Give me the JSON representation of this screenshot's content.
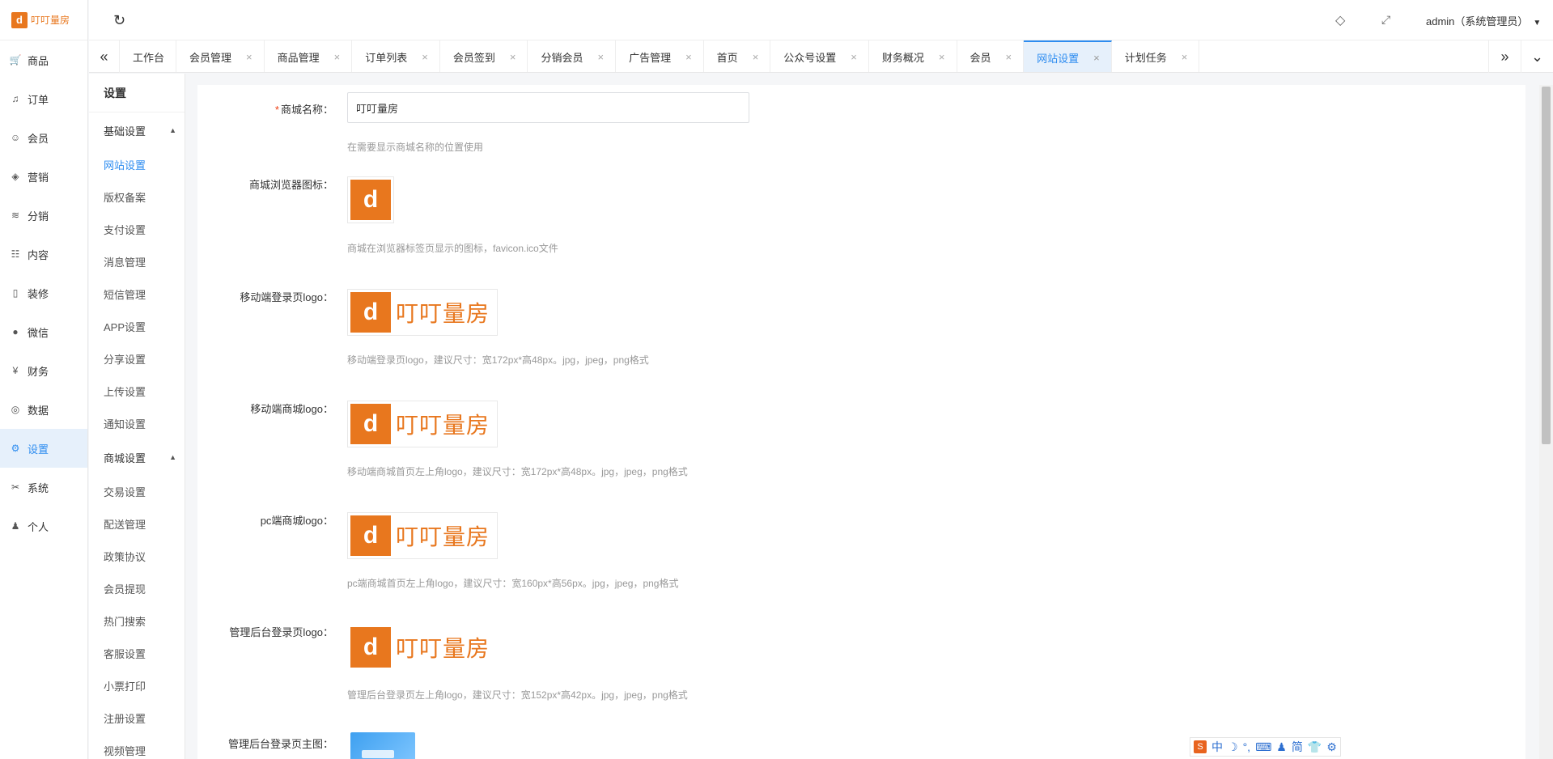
{
  "brand": {
    "logo_text": "叮叮量房",
    "logo_glyph": "d",
    "accent": "#e8771e"
  },
  "left_nav": [
    {
      "label": "商品",
      "icon": "cart-icon",
      "glyph": "🛒"
    },
    {
      "label": "订单",
      "icon": "bell-icon",
      "glyph": "♫"
    },
    {
      "label": "会员",
      "icon": "user-icon",
      "glyph": "☺"
    },
    {
      "label": "营销",
      "icon": "cube-icon",
      "glyph": "◈"
    },
    {
      "label": "分销",
      "icon": "layers-icon",
      "glyph": "≋"
    },
    {
      "label": "内容",
      "icon": "book-icon",
      "glyph": "☷"
    },
    {
      "label": "装修",
      "icon": "phone-icon",
      "glyph": "▯"
    },
    {
      "label": "微信",
      "icon": "wechat-icon",
      "glyph": "●"
    },
    {
      "label": "财务",
      "icon": "yen-icon",
      "glyph": "¥"
    },
    {
      "label": "数据",
      "icon": "globe-icon",
      "glyph": "◎"
    },
    {
      "label": "设置",
      "icon": "gear-icon",
      "glyph": "⚙"
    },
    {
      "label": "系统",
      "icon": "tools-icon",
      "glyph": "✂"
    },
    {
      "label": "个人",
      "icon": "person-icon",
      "glyph": "♟"
    }
  ],
  "header": {
    "user_label": "admin（系统管理员）",
    "refresh_glyph": "↻",
    "tag_glyph": "◇",
    "fullscreen_glyph": "⤢"
  },
  "tabs": [
    {
      "label": "工作台",
      "closable": false
    },
    {
      "label": "会员管理",
      "closable": true
    },
    {
      "label": "商品管理",
      "closable": true
    },
    {
      "label": "订单列表",
      "closable": true
    },
    {
      "label": "会员签到",
      "closable": true
    },
    {
      "label": "分销会员",
      "closable": true
    },
    {
      "label": "广告管理",
      "closable": true
    },
    {
      "label": "首页",
      "closable": true
    },
    {
      "label": "公众号设置",
      "closable": true
    },
    {
      "label": "财务概况",
      "closable": true
    },
    {
      "label": "会员",
      "closable": true
    },
    {
      "label": "网站设置",
      "closable": true,
      "active": true
    },
    {
      "label": "计划任务",
      "closable": true
    }
  ],
  "submenu": {
    "title": "设置",
    "groups": [
      {
        "label": "基础设置",
        "items": [
          "网站设置",
          "版权备案",
          "支付设置",
          "消息管理",
          "短信管理",
          "APP设置",
          "分享设置",
          "上传设置",
          "通知设置"
        ]
      },
      {
        "label": "商城设置",
        "items": [
          "交易设置",
          "配送管理",
          "政策协议",
          "会员提现",
          "热门搜索",
          "客服设置",
          "小票打印",
          "注册设置",
          "视频管理"
        ]
      }
    ],
    "active_item": "网站设置"
  },
  "form": {
    "shop_name": {
      "label": "商城名称：",
      "value": "叮叮量房",
      "hint": "在需要显示商城名称的位置使用"
    },
    "favicon": {
      "label": "商城浏览器图标：",
      "hint": "商城在浏览器标签页显示的图标，favicon.ico文件"
    },
    "mobile_login_logo": {
      "label": "移动端登录页logo：",
      "hint": "移动端登录页logo，建议尺寸：宽172px*高48px。jpg，jpeg，png格式"
    },
    "mobile_shop_logo": {
      "label": "移动端商城logo：",
      "hint": "移动端商城首页左上角logo，建议尺寸：宽172px*高48px。jpg，jpeg，png格式"
    },
    "pc_shop_logo": {
      "label": "pc端商城logo：",
      "hint": "pc端商城首页左上角logo，建议尺寸：宽160px*高56px。jpg，jpeg，png格式"
    },
    "admin_login_logo": {
      "label": "管理后台登录页logo：",
      "hint": "管理后台登录页左上角logo，建议尺寸：宽152px*高42px。jpg，jpeg，png格式"
    },
    "admin_login_banner": {
      "label": "管理后台登录页主图："
    }
  },
  "ime_bar": {
    "items": [
      "中",
      "☽",
      "°,",
      "⌨",
      "♟",
      "简",
      "👕",
      "⚙"
    ]
  }
}
